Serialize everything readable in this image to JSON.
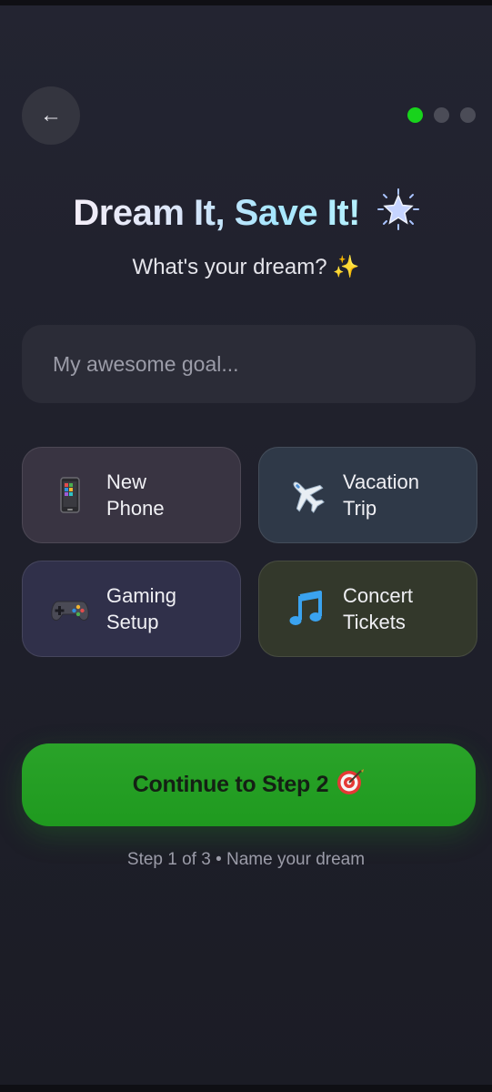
{
  "header": {
    "back_label": "←",
    "step_dots": [
      true,
      false,
      false
    ]
  },
  "hero": {
    "title": "Dream It, Save It!",
    "subtitle": "What's your dream?",
    "title_icon": "glowing-star-icon",
    "subtitle_icon": "sparkles-icon"
  },
  "goal": {
    "value": "",
    "placeholder": "My awesome goal..."
  },
  "suggestions": [
    {
      "label": "New Phone",
      "icon": "mobile-phone-icon"
    },
    {
      "label": "Vacation Trip",
      "icon": "airplane-icon"
    },
    {
      "label": "Gaming Setup",
      "icon": "game-controller-icon"
    },
    {
      "label": "Concert Tickets",
      "icon": "music-note-icon"
    }
  ],
  "actions": {
    "continue_label": "Continue to Step 2",
    "continue_icon": "target-icon"
  },
  "footer": {
    "step_caption": "Step 1 of 3 • Name your dream"
  },
  "colors": {
    "accent_green": "#1f9a1f",
    "active_dot": "#18d31c",
    "background": "#1f202b"
  }
}
